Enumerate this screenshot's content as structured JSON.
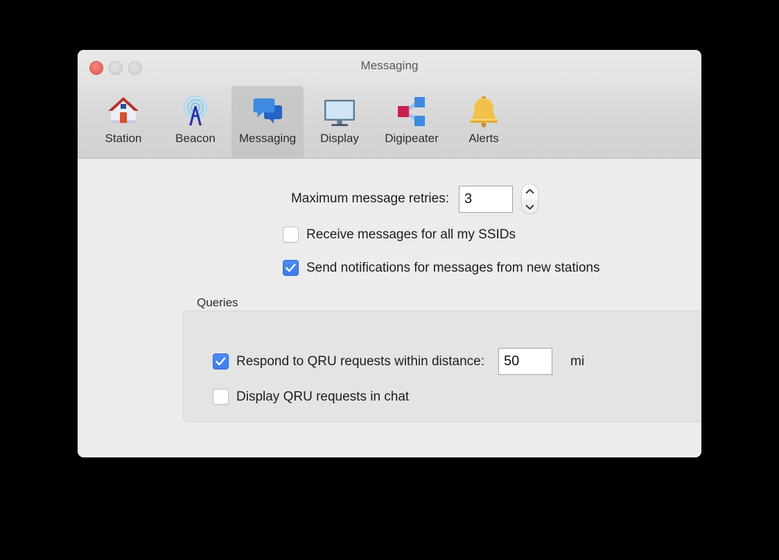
{
  "window": {
    "title": "Messaging",
    "controls": {
      "close": "close-button",
      "minimize": "minimize-button",
      "zoom": "zoom-button"
    }
  },
  "toolbar": {
    "selected": "Messaging",
    "tabs": [
      {
        "label": "Station",
        "icon": "house-icon",
        "selected": false
      },
      {
        "label": "Beacon",
        "icon": "antenna-icon",
        "selected": false
      },
      {
        "label": "Messaging",
        "icon": "speech-bubbles-icon",
        "selected": true
      },
      {
        "label": "Display",
        "icon": "monitor-icon",
        "selected": false
      },
      {
        "label": "Digipeater",
        "icon": "share-nodes-icon",
        "selected": false
      },
      {
        "label": "Alerts",
        "icon": "bell-icon",
        "selected": false
      }
    ]
  },
  "content": {
    "retries": {
      "label": "Maximum message retries:",
      "value": "3",
      "stepper": {
        "up": "stepper-up-arrow",
        "down": "stepper-down-arrow"
      }
    },
    "receive_all_ssids": {
      "label": "Receive messages for all my SSIDs",
      "checked": false
    },
    "notify_new_stations": {
      "label": "Send notifications for messages from new stations",
      "checked": true
    },
    "queries": {
      "caption": "Queries",
      "respond_qru": {
        "label": "Respond to QRU requests within distance:",
        "checked": true,
        "distance": "50",
        "unit": "mi"
      },
      "display_qru_chat": {
        "label": "Display QRU requests in chat",
        "checked": false
      }
    }
  },
  "colors": {
    "accent_checkbox": "#3d7ced",
    "window_background": "#ececec",
    "toolbar_background": "#d4d4d4",
    "close_button": "#ea6a5d",
    "group_background": "#e4e4e4"
  }
}
